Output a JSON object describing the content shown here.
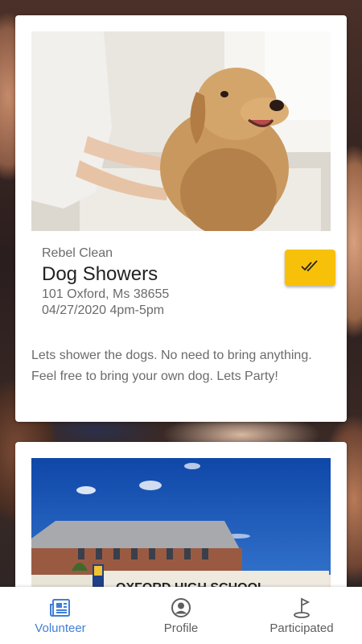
{
  "cards": [
    {
      "organization": "Rebel Clean",
      "title": "Dog Showers",
      "address": "101 Oxford, Ms 38655",
      "datetime": "04/27/2020 4pm-5pm",
      "description": "Lets shower the dogs. No need to bring anything. Feel free to bring your own dog. Lets Party!",
      "action_icon": "double-check-icon",
      "action_color": "#f8c109"
    },
    {
      "image_text": "OXFORD HIGH SCHOOL"
    }
  ],
  "bottom_nav": {
    "items": [
      {
        "label": "Volunteer",
        "icon": "newspaper-icon",
        "active": true
      },
      {
        "label": "Profile",
        "icon": "user-circle-icon",
        "active": false
      },
      {
        "label": "Participated",
        "icon": "flag-icon",
        "active": false
      }
    ],
    "active_color": "#3f7fd6",
    "inactive_color": "#5e5e5e"
  }
}
